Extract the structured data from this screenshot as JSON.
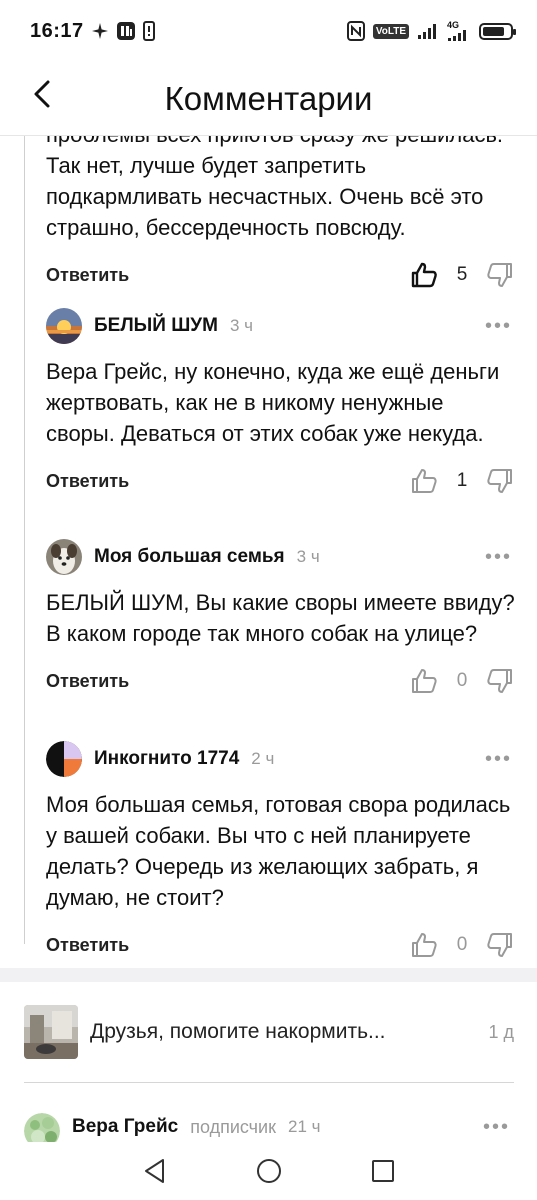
{
  "status_bar": {
    "time": "16:17",
    "network": "4G",
    "volte": "VoLTE"
  },
  "header": {
    "title": "Комментарии",
    "back_icon": "chevron-left-icon"
  },
  "comments": [
    {
      "text": "проблемы всех приютов сразу же решилась. Так нет, лучше будет запретить подкармливать несчастных. Очень всё это страшно, бессердечность повсюду.",
      "reply_label": "Ответить",
      "likes": "5",
      "liked": true
    },
    {
      "author": "БЕЛЫЙ ШУМ",
      "time": "3 ч",
      "text": "Вера Грейс, ну конечно, куда же ещё деньги жертвовать, как не в никому ненужные своры. Деваться от этих собак уже некуда.",
      "reply_label": "Ответить",
      "likes": "1"
    },
    {
      "author": "Моя большая семья",
      "time": "3 ч",
      "text": "БЕЛЫЙ ШУМ, Вы какие своры имеете ввиду? В каком городе так много собак на улице?",
      "reply_label": "Ответить",
      "likes": "0"
    },
    {
      "author": "Инкогнито 1774",
      "time": "2 ч",
      "text": "Моя большая семья, готовая свора родилась у вашей собаки. Вы что с ней планируете делать? Очередь из желающих забрать, я думаю, не стоит?",
      "reply_label": "Ответить",
      "likes": "0"
    }
  ],
  "related": {
    "title": "Друзья, помогите накормить...",
    "age": "1 д"
  },
  "next_comment": {
    "author": "Вера Грейс",
    "badge": "подписчик",
    "time": "21 ч"
  },
  "more_label": "•••",
  "colors": {
    "text": "#111111",
    "muted": "#9a9a9a",
    "background": "#ffffff",
    "separator": "#f1f1f3"
  }
}
